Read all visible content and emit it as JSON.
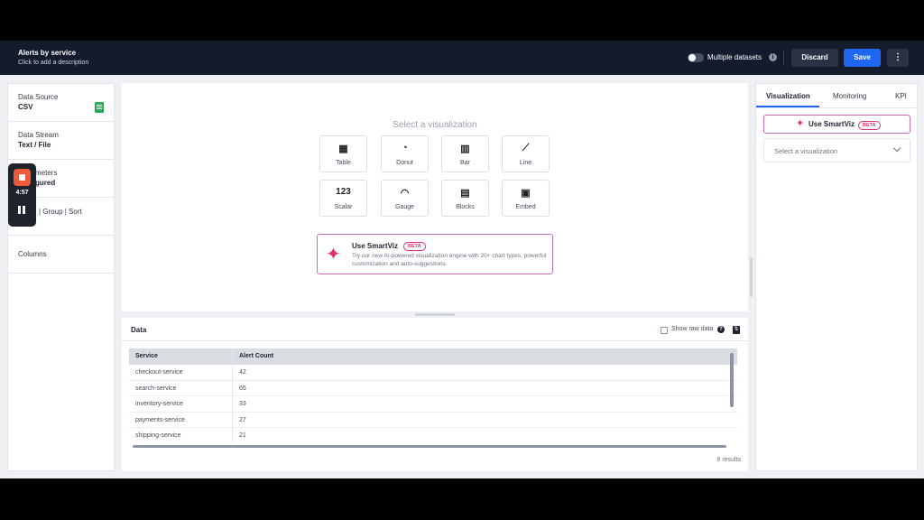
{
  "header": {
    "title": "Alerts by service",
    "subtitle": "Click to add a description",
    "multiple_datasets_label": "Multiple datasets",
    "multiple_datasets_on": false,
    "discard_label": "Discard",
    "save_label": "Save",
    "more_icon": "more-vertical-icon"
  },
  "left_panel": {
    "items": [
      {
        "label": "Data Source",
        "value": "CSV"
      },
      {
        "label": "Data Stream",
        "value": "Text / File"
      },
      {
        "label": "meters",
        "value": "gured"
      },
      {
        "label": "| Group | Sort",
        "value": ""
      },
      {
        "label": "Columns",
        "value": ""
      }
    ]
  },
  "recorder": {
    "time": "4:57"
  },
  "viz": {
    "prompt": "Select a visualization",
    "tiles": [
      {
        "label": "Table",
        "icon": "table-icon",
        "glyph": "▦"
      },
      {
        "label": "Donut",
        "icon": "donut-icon",
        "glyph": "◔"
      },
      {
        "label": "Bar",
        "icon": "bar-chart-icon",
        "glyph": "▥"
      },
      {
        "label": "Line",
        "icon": "line-chart-icon",
        "glyph": "⟋"
      },
      {
        "label": "Scalar",
        "icon": "scalar-icon",
        "glyph": "123"
      },
      {
        "label": "Gauge",
        "icon": "gauge-icon",
        "glyph": "◠"
      },
      {
        "label": "Blocks",
        "icon": "blocks-icon",
        "glyph": "▤"
      },
      {
        "label": "Embed",
        "icon": "embed-icon",
        "glyph": "▣"
      }
    ],
    "smartviz": {
      "title": "Use SmartViz",
      "badge": "BETA",
      "description": "Try our new AI-powered visualization engine with 20+ chart types, powerful customization and auto-suggestions."
    }
  },
  "data_panel": {
    "title": "Data",
    "show_raw_label": "Show raw data",
    "columns": [
      "Service",
      "Alert Count"
    ],
    "rows": [
      [
        "checkout-service",
        "42"
      ],
      [
        "search-service",
        "65"
      ],
      [
        "inventory-service",
        "33"
      ],
      [
        "payments-service",
        "27"
      ],
      [
        "shipping-service",
        "21"
      ]
    ],
    "results": "8 results"
  },
  "right_panel": {
    "tabs": [
      "Visualization",
      "Monitoring",
      "KPI"
    ],
    "active_tab": "Visualization",
    "smartviz_label": "Use SmartViz",
    "smartviz_badge": "BETA",
    "select_placeholder": "Select a visualization"
  },
  "colors": {
    "topbar": "#141b2d",
    "accent": "#1f66f0",
    "smart": "#e0316d"
  }
}
